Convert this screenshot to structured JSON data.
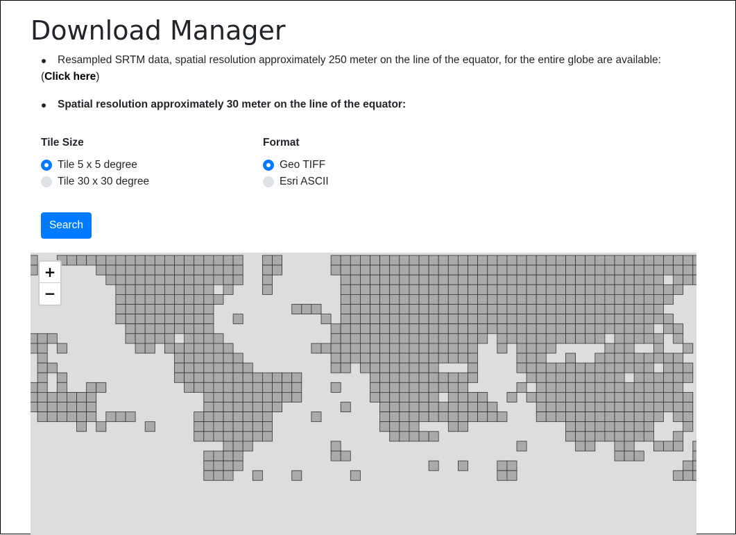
{
  "page": {
    "title": "Download Manager"
  },
  "info": {
    "line1_text": "Resampled SRTM data, spatial resolution approximately 250 meter on the line of the equator, for the entire globe are available:",
    "line1_open": "(",
    "line1_link": "Click here",
    "line1_close": ")",
    "line2_text": "Spatial resolution approximately 30 meter on the line of the equator:"
  },
  "tile_size": {
    "heading": "Tile Size",
    "options": [
      {
        "label": "Tile 5 x 5 degree",
        "checked": true
      },
      {
        "label": "Tile 30 x 30 degree",
        "checked": false
      }
    ]
  },
  "format": {
    "heading": "Format",
    "options": [
      {
        "label": "Geo TIFF",
        "checked": true
      },
      {
        "label": "Esri ASCII",
        "checked": false
      }
    ]
  },
  "search_button": {
    "label": "Search"
  },
  "map": {
    "zoom_in_label": "+",
    "zoom_out_label": "−",
    "tile_fill": "#aaaaaa",
    "tile_stroke": "#333333",
    "background": "#dddddd"
  },
  "colors": {
    "accent": "#007bff",
    "radio_unchecked": "#dee2e6"
  }
}
